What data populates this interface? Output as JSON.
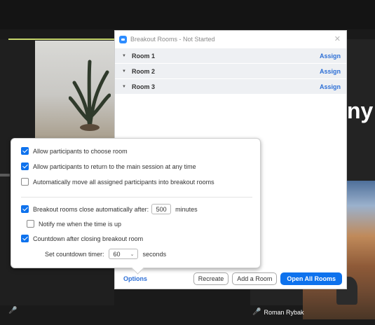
{
  "background": {
    "big_text": "ny",
    "participant_name": "Roman Rybak"
  },
  "dialog": {
    "title": "Breakout Rooms - Not Started",
    "close_glyph": "✕",
    "rooms": [
      {
        "name": "Room 1",
        "action": "Assign"
      },
      {
        "name": "Room 2",
        "action": "Assign"
      },
      {
        "name": "Room 3",
        "action": "Assign"
      }
    ],
    "footer": {
      "options_label": "Options",
      "recreate_label": "Recreate",
      "add_room_label": "Add a Room",
      "open_all_label": "Open All Rooms"
    }
  },
  "options": {
    "allow_choose": {
      "label": "Allow participants to choose room",
      "checked": true
    },
    "allow_return": {
      "label": "Allow participants to return to the main session at any time",
      "checked": true
    },
    "auto_move": {
      "label": "Automatically move all assigned participants into breakout rooms",
      "checked": false
    },
    "auto_close": {
      "label": "Breakout rooms close automatically after:",
      "value": "500",
      "unit": "minutes",
      "checked": true
    },
    "notify": {
      "label": "Notify me when the time is up",
      "checked": false
    },
    "countdown": {
      "label": "Countdown after closing breakout room",
      "checked": true
    },
    "countdown_timer": {
      "label": "Set countdown timer:",
      "value": "60",
      "unit": "seconds"
    }
  },
  "colors": {
    "accent": "#0e72ed",
    "link": "#2d6fd6",
    "muted_indicator": "#e0413f"
  },
  "icons": {
    "dropdown": "⌄",
    "room_chevron": "▼",
    "mic_off": "🎤"
  }
}
